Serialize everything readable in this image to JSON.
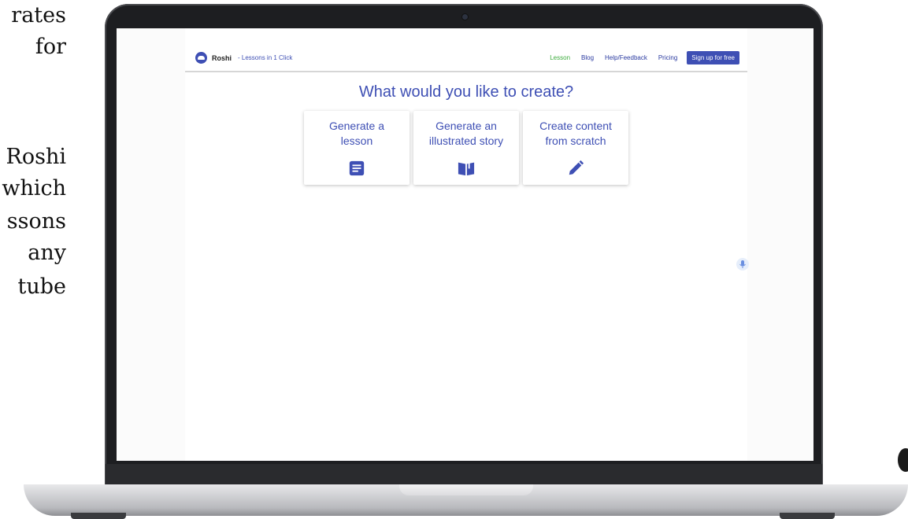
{
  "side_text": [
    "rates",
    "for",
    "Roshi",
    "which",
    "ssons",
    "any",
    "tube"
  ],
  "nav": {
    "brand_name": "Roshi",
    "brand_tagline": "- Lessons in 1 Click",
    "links": [
      "Lesson",
      "Blog",
      "Help/Feedback",
      "Pricing"
    ],
    "cta": "Sign up for free"
  },
  "main": {
    "heading": "What would you like to create?",
    "cards": [
      {
        "line1": "Generate a",
        "line2": "lesson",
        "icon": "document-icon"
      },
      {
        "line1": "Generate an",
        "line2": "illustrated story",
        "icon": "open-book-icon"
      },
      {
        "line1": "Create content",
        "line2": "from scratch",
        "icon": "pencil-icon"
      }
    ]
  },
  "colors": {
    "accent": "#3e4fb4",
    "active_link": "#3cab3c",
    "laptop_bezel": "#1d1e21"
  }
}
